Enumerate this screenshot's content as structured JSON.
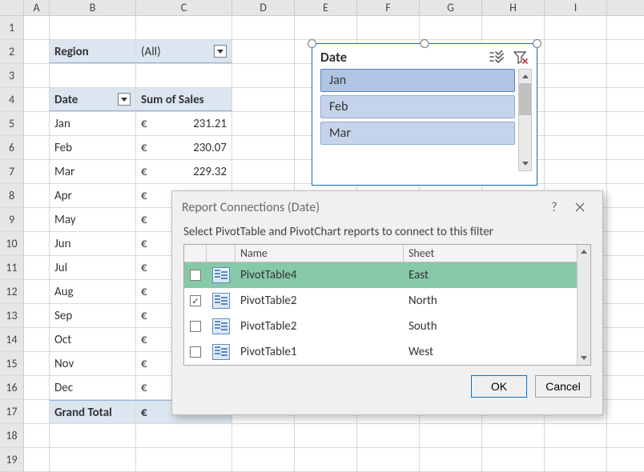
{
  "columns": [
    "A",
    "B",
    "C",
    "D",
    "E",
    "F",
    "G",
    "H",
    "I"
  ],
  "row_count": 19,
  "pivot_filter": {
    "label": "Region",
    "value": "(All)"
  },
  "pivot_row_header": "Date",
  "pivot_value_header": "Sum of Sales",
  "currency_symbol": "€",
  "pivot_rows": [
    {
      "label": "Jan",
      "value": "231.21"
    },
    {
      "label": "Feb",
      "value": "230.07"
    },
    {
      "label": "Mar",
      "value": "229.32"
    },
    {
      "label": "Apr",
      "value": ""
    },
    {
      "label": "May",
      "value": ""
    },
    {
      "label": "Jun",
      "value": ""
    },
    {
      "label": "Jul",
      "value": ""
    },
    {
      "label": "Aug",
      "value": ""
    },
    {
      "label": "Sep",
      "value": ""
    },
    {
      "label": "Oct",
      "value": ""
    },
    {
      "label": "Nov",
      "value": ""
    },
    {
      "label": "Dec",
      "value": ""
    }
  ],
  "grand_total_label": "Grand Total",
  "slicer": {
    "title": "Date",
    "items": [
      "Jan",
      "Feb",
      "Mar"
    ],
    "selected_index": 0
  },
  "dialog": {
    "title": "Report Connections (Date)",
    "message": "Select PivotTable and PivotChart reports to connect to this filter",
    "columns": {
      "name": "Name",
      "sheet": "Sheet"
    },
    "rows": [
      {
        "checked": false,
        "name": "PivotTable4",
        "sheet": "East",
        "selected": true
      },
      {
        "checked": true,
        "name": "PivotTable2",
        "sheet": "North",
        "selected": false
      },
      {
        "checked": false,
        "name": "PivotTable2",
        "sheet": "South",
        "selected": false
      },
      {
        "checked": false,
        "name": "PivotTable1",
        "sheet": "West",
        "selected": false
      }
    ],
    "ok": "OK",
    "cancel": "Cancel"
  }
}
